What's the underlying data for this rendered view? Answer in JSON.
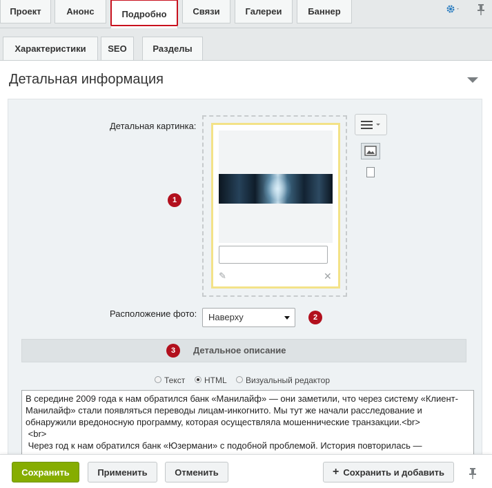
{
  "tabs_row1": [
    "Проект",
    "Анонс",
    "Подробно",
    "Связи",
    "Галереи",
    "Баннер"
  ],
  "tabs_row2": [
    "Характеристики",
    "SEO",
    "Разделы"
  ],
  "section": {
    "title": "Детальная информация"
  },
  "image_field": {
    "label": "Детальная картинка:"
  },
  "photo_position": {
    "label": "Расположение фото:",
    "value": "Наверху"
  },
  "badges": [
    "1",
    "2",
    "3"
  ],
  "description": {
    "title": "Детальное описание",
    "modes": [
      "Текст",
      "HTML",
      "Визуальный редактор"
    ],
    "selected_mode": "HTML",
    "text": "В середине 2009 года к нам обратился банк «Манилайф» — они заметили, что через систему «Клиент-Манилайф» стали появляться переводы лицам-инкогнито. Мы тут же начали расследование и обнаружили вредоносную программу, которая осуществляла мошеннические транзакции.<br>\n <br>\n Через год к нам обратился банк «Юзермани» с подобной проблемой. История повторилась — вредоносная программа привела к потере денежных средств. Мы проанализировали код этих"
  },
  "footer": {
    "save": "Сохранить",
    "apply": "Применить",
    "cancel": "Отменить",
    "save_add": "Сохранить и добавить"
  },
  "colors": {
    "accent_green": "#86ad00",
    "badge_red": "#b2101d",
    "highlight_red": "#c8101d",
    "settings_blue": "#2f7fc1"
  }
}
